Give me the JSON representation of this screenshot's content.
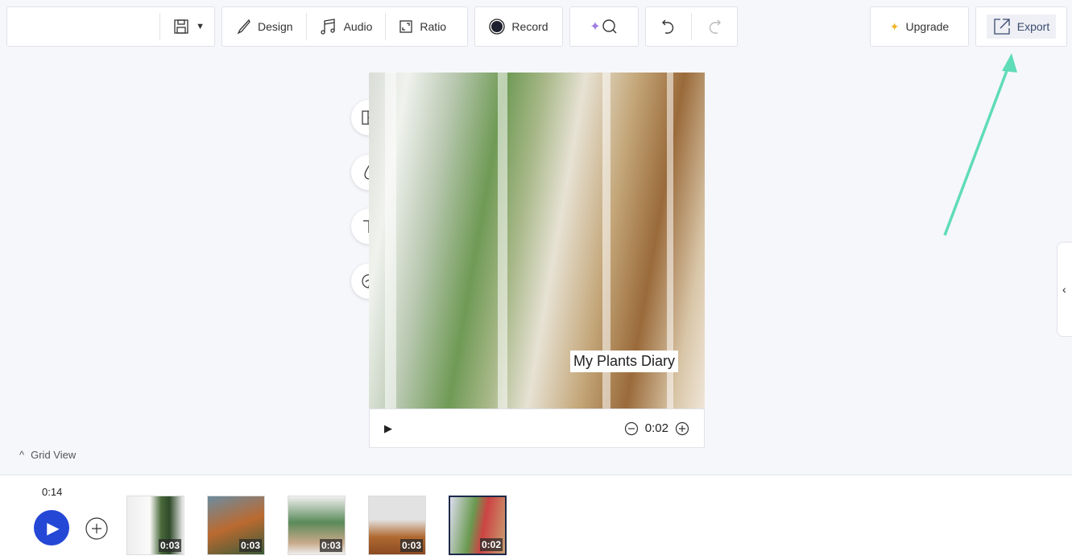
{
  "toolbar": {
    "design": "Design",
    "audio": "Audio",
    "ratio": "Ratio",
    "record": "Record",
    "upgrade": "Upgrade",
    "export": "Export"
  },
  "canvas": {
    "caption": "My Plants Diary",
    "time": "0:02"
  },
  "grid_view": "Grid View",
  "timeline": {
    "total": "0:14",
    "clips": [
      {
        "duration": "0:03"
      },
      {
        "duration": "0:03"
      },
      {
        "duration": "0:03"
      },
      {
        "duration": "0:03"
      },
      {
        "duration": "0:02",
        "selected": true
      }
    ]
  },
  "colors": {
    "accent": "#2447d6",
    "arrow": "#5fdcb8",
    "sparkle": "#a17de0",
    "upgrade_star": "#f0b429"
  }
}
